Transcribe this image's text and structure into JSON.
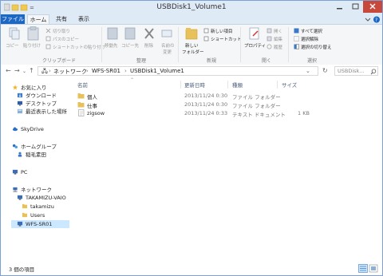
{
  "window": {
    "title": "USBDisk1_Volume1"
  },
  "tabs": [
    {
      "label": "ファイル"
    },
    {
      "label": "ホーム"
    },
    {
      "label": "共有"
    },
    {
      "label": "表示"
    }
  ],
  "ribbon": {
    "clipboard": {
      "copy": "コピー",
      "paste": "貼り付け",
      "cut": "切り取り",
      "copy_path": "パスのコピー",
      "paste_shortcut": "ショートカットの貼り付け",
      "group": "クリップボード"
    },
    "organize": {
      "move_to": "移動先",
      "copy_to": "コピー先",
      "delete": "削除",
      "rename_1": "名前の",
      "rename_2": "変更",
      "group": "整理"
    },
    "new": {
      "new_folder_1": "新しい",
      "new_folder_2": "フォルダー",
      "new_item": "新しい項目",
      "easy_access": "ショートカット",
      "group": "新規"
    },
    "open": {
      "properties": "プロパティ",
      "open": "開く",
      "edit": "編集",
      "history": "履歴",
      "group": "開く"
    },
    "select": {
      "select_all": "すべて選択",
      "select_none": "選択解除",
      "invert": "選択の切り替え",
      "group": "選択"
    }
  },
  "address": {
    "crumbs": [
      "ネットワーク",
      "WFS-SR01",
      "USBDisk1_Volume1"
    ],
    "search_placeholder": "USBDisk..."
  },
  "nav": {
    "favorites": "お気に入り",
    "downloads": "ダウンロード",
    "desktop": "デスクトップ",
    "recent": "最近表示した場所",
    "skydrive": "SkyDrive",
    "homegroup": "ホームグループ",
    "homegroup_user": "稲毛素田",
    "pc": "PC",
    "network": "ネットワーク",
    "host": "TAKAMIZU-VAIO",
    "share1": "takamizu",
    "share2": "Users",
    "selected": "WFS-SR01"
  },
  "columns": {
    "name": "名前",
    "date": "更新日時",
    "type": "種類",
    "size": "サイズ"
  },
  "files": [
    {
      "name": "個人",
      "date": "2013/11/24 0:30",
      "type": "ファイル フォルダー",
      "size": ""
    },
    {
      "name": "仕事",
      "date": "2013/11/24 0:30",
      "type": "ファイル フォルダー",
      "size": ""
    },
    {
      "name": "zigsow",
      "date": "2013/11/24 0:33",
      "type": "テキスト ドキュメント",
      "size": "1 KB"
    }
  ],
  "status": {
    "item_count": "3 個の項目"
  },
  "colors": {
    "accent": "#1c67c4",
    "selection": "#cce8ff",
    "folder": "#e8c15a"
  }
}
